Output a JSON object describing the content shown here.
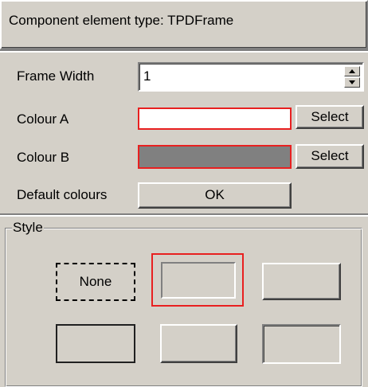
{
  "header": {
    "text": "Component element type: TPDFrame"
  },
  "frame_width": {
    "label": "Frame Width",
    "value": "1"
  },
  "colour_a": {
    "label": "Colour A",
    "swatch_color": "#ffffff",
    "select_label": "Select"
  },
  "colour_b": {
    "label": "Colour B",
    "swatch_color": "#808080",
    "select_label": "Select"
  },
  "default_colours": {
    "label": "Default colours",
    "button_label": "OK"
  },
  "style_group": {
    "title": "Style",
    "none_label": "None",
    "selected_index": 1,
    "selection_color": "#e82020"
  }
}
